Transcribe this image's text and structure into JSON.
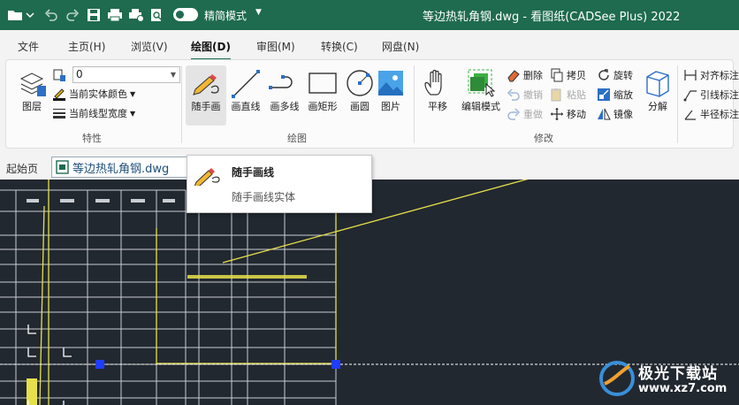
{
  "app": {
    "title": "等边热轧角钢.dwg - 看图纸(CADSee Plus) 2022",
    "mode_label": "精简模式"
  },
  "menu": {
    "tabs": [
      {
        "label": "文件"
      },
      {
        "label": "主页(H)"
      },
      {
        "label": "浏览(V)"
      },
      {
        "label": "绘图(D)"
      },
      {
        "label": "审图(M)"
      },
      {
        "label": "转换(C)"
      },
      {
        "label": "网盘(N)"
      }
    ],
    "active_tab": "绘图(D)"
  },
  "ribbon": {
    "properties": {
      "group_label": "特性",
      "layer_label": "图层",
      "layer_value": "0",
      "color_label": "当前实体颜色",
      "linewidth_label": "当前线型宽度"
    },
    "draw": {
      "group_label": "绘图",
      "tools": [
        {
          "label": "随手画",
          "icon": "pencil-icon"
        },
        {
          "label": "画直线",
          "icon": "line-icon"
        },
        {
          "label": "画多线",
          "icon": "polyline-icon"
        },
        {
          "label": "画矩形",
          "icon": "rectangle-icon"
        },
        {
          "label": "画圆",
          "icon": "circle-icon"
        },
        {
          "label": "图片",
          "icon": "image-icon"
        }
      ]
    },
    "modify": {
      "group_label": "修改",
      "pan_label": "平移",
      "edit_mode_label": "编辑模式",
      "delete_label": "删除",
      "copy_label": "拷贝",
      "rotate_label": "旋转",
      "undo_label": "撤销",
      "paste_label": "粘贴",
      "scale_label": "缩放",
      "redo_label": "重做",
      "move_label": "移动",
      "mirror_label": "镜像",
      "explode_label": "分解"
    },
    "annotate": {
      "align_label": "对齐标注",
      "leader_label": "引线标注",
      "radius_label": "半径标注"
    }
  },
  "docbar": {
    "start_page": "起始页",
    "doc_tab": "等边热轧角钢.dwg"
  },
  "tooltip": {
    "title": "随手画线",
    "description": "随手画线实体"
  },
  "watermark": {
    "text": "极光下载站",
    "url": "www.xz7.com"
  },
  "colors": {
    "titlebar": "#1e6b4f",
    "canvas": "#222830",
    "cad_line": "#e6e04a",
    "grip": "#1f3cff"
  }
}
